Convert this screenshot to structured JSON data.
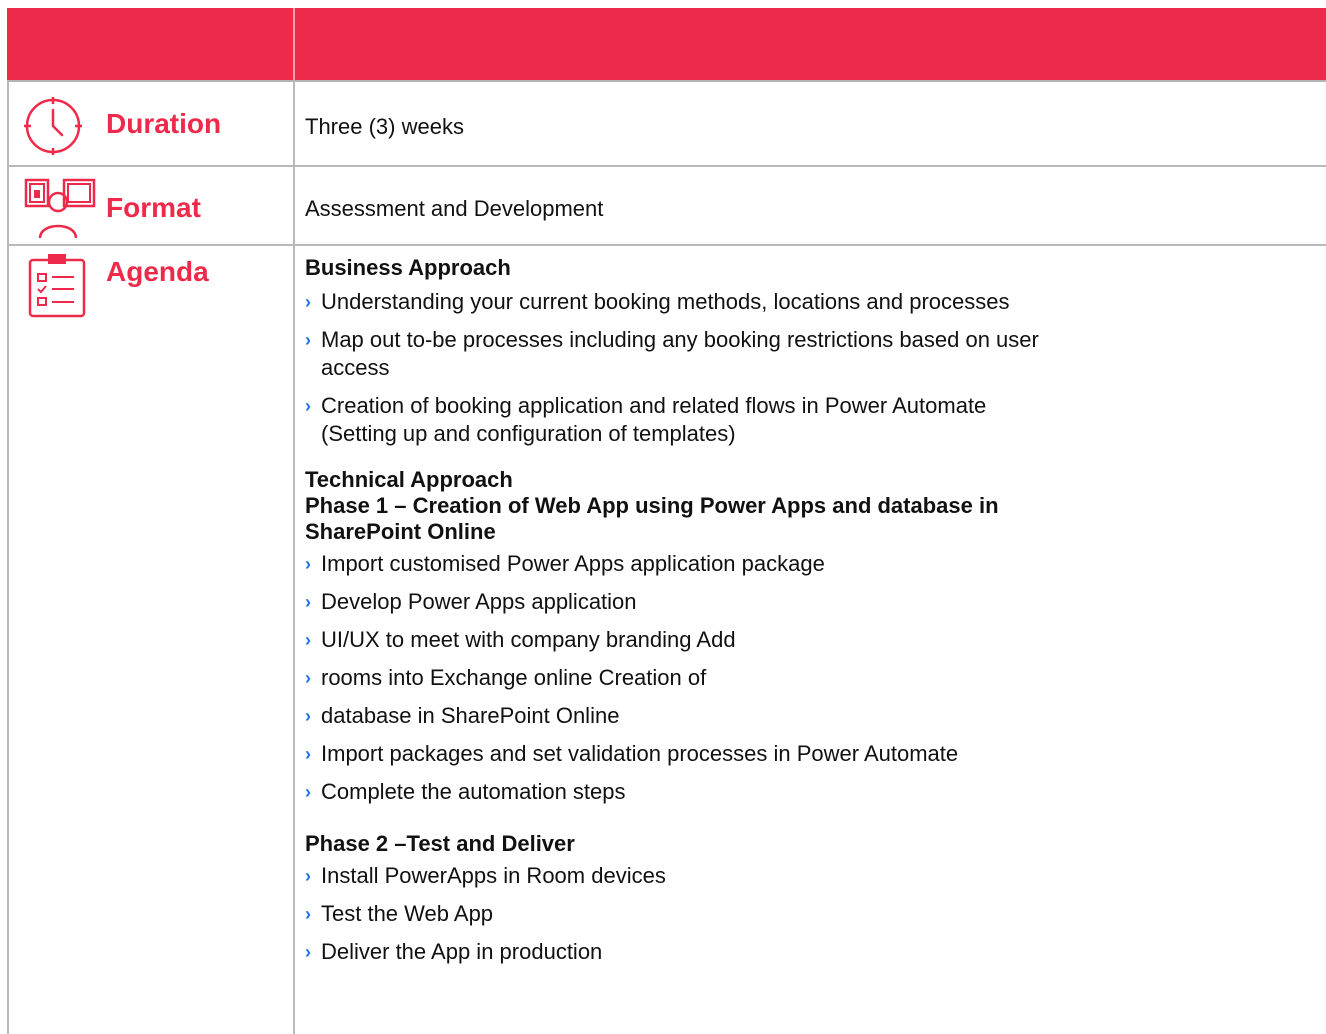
{
  "colors": {
    "accent": "#ee2a4a",
    "bullet": "#1e73e8",
    "text": "#111111",
    "rule": "#b9b9b9"
  },
  "rows": {
    "duration": {
      "label": "Duration",
      "value": "Three (3) weeks",
      "icon": "clock-icon"
    },
    "format": {
      "label": "Format",
      "value": "Assessment and Development",
      "icon": "presentation-icon"
    },
    "agenda": {
      "label": "Agenda",
      "icon": "clipboard-checklist-icon"
    }
  },
  "agenda": {
    "business_heading": "Business Approach",
    "business_items": [
      "Understanding your current booking methods, locations and processes",
      "Map out to-be processes including any booking restrictions based on  user",
      "access",
      "Creation of booking application and related flows in Power Automate",
      "(Setting up and configuration of templates)"
    ],
    "technical_heading": "Technical Approach",
    "phase1_heading_line1": "Phase 1 – Creation of Web App using Power Apps and database in",
    "phase1_heading_line2": "SharePoint Online",
    "phase1_items": [
      "Import customised Power Apps application package",
      "Develop Power Apps application",
      "UI/UX to meet with company branding  Add",
      "rooms into Exchange online  Creation of",
      "database in SharePoint Online",
      "Import packages and set validation processes in Power Automate",
      "Complete the automation steps"
    ],
    "phase2_heading": "Phase 2 –Test and Deliver",
    "phase2_items": [
      "Install PowerApps in Room devices",
      "Test the Web App",
      "Deliver the App in production"
    ],
    "bullet_glyph": "›"
  }
}
